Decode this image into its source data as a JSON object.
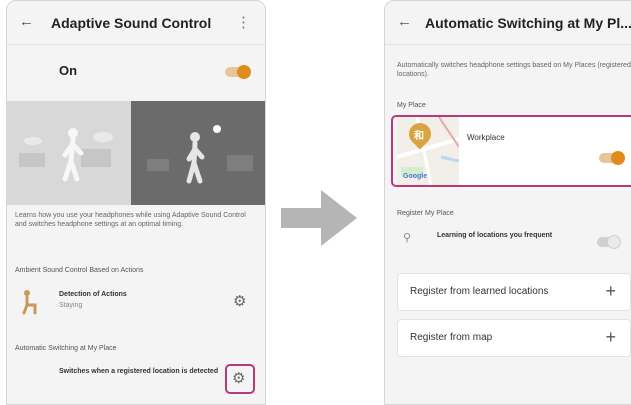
{
  "left_screen": {
    "title": "Adaptive Sound Control",
    "on_label": "On",
    "on_toggle": true,
    "description": "Learns how you use your headphones while using Adaptive Sound Control and switches headphone settings at an optimal timing.",
    "ambient_section": "Ambient Sound Control Based on Actions",
    "detection_title": "Detection of Actions",
    "detection_status": "Staying",
    "auto_switch_section": "Automatic Switching at My Place",
    "auto_switch_text": "Switches when a registered location is detected"
  },
  "right_screen": {
    "title": "Automatic Switching at My Pl...",
    "description": "Automatically switches headphone settings based on My Places (registered locations).",
    "my_place_section": "My Place",
    "workplace_label": "Workplace",
    "workplace_toggle": true,
    "map_pin_label": "和",
    "map_brand": "Google",
    "register_section": "Register My Place",
    "learning_label": "Learning of locations you frequent",
    "learning_toggle": false,
    "register_learned": "Register from learned locations",
    "register_map": "Register from map"
  },
  "icons": {
    "back": "←",
    "menu": "⋮",
    "gear": "⚙",
    "plus": "+",
    "location": "⚲"
  },
  "colors": {
    "accent_orange": "#e08c1c",
    "highlight_magenta": "#b63a78",
    "arrow_gray": "#b5b5b5"
  }
}
